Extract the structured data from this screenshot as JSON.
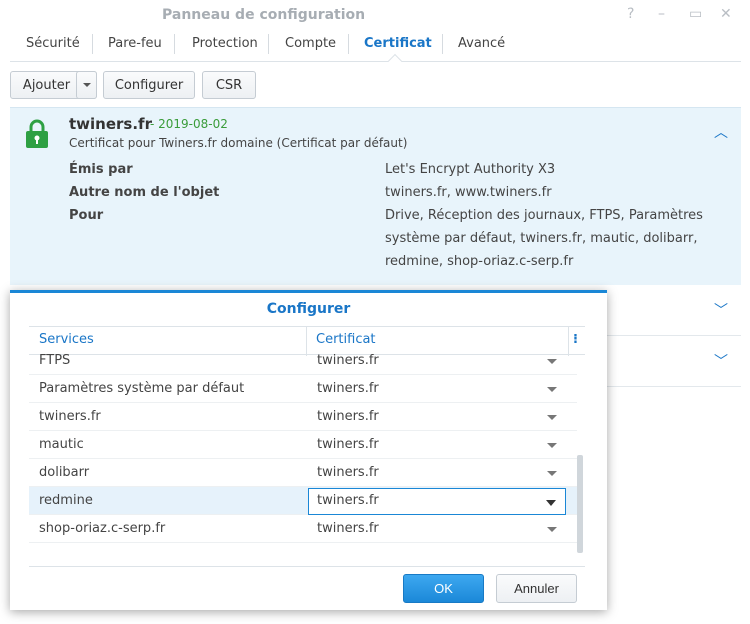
{
  "window": {
    "title": "Panneau de configuration",
    "controls": [
      "help-icon",
      "minimize-icon",
      "maximize-icon",
      "close-icon"
    ]
  },
  "tabs": [
    {
      "label": "Sécurité"
    },
    {
      "label": "Pare-feu"
    },
    {
      "label": "Protection"
    },
    {
      "label": "Compte"
    },
    {
      "label": "Certificat",
      "active": true
    },
    {
      "label": "Avancé"
    }
  ],
  "toolbar": {
    "add_label": "Ajouter",
    "configure_label": "Configurer",
    "csr_label": "CSR"
  },
  "certificate": {
    "name": "twiners.fr",
    "date": "- 2019-08-02",
    "description": "Certificat pour Twiners.fr domaine (Certificat par défaut)",
    "fields": [
      {
        "label": "Émis par",
        "value": "Let's Encrypt Authority X3"
      },
      {
        "label": "Autre nom de l'objet",
        "value": "twiners.fr, www.twiners.fr"
      },
      {
        "label": "Pour",
        "value": "Drive, Réception des journaux, FTPS, Paramètres système par défaut, twiners.fr, mautic, dolibarr, redmine, shop-oriaz.c-serp.fr"
      }
    ]
  },
  "dialog": {
    "title": "Configurer",
    "columns": [
      "Services",
      "Certificat"
    ],
    "rows": [
      {
        "service": "FTPS",
        "certificate": "twiners.fr"
      },
      {
        "service": "Paramètres système par défaut",
        "certificate": "twiners.fr"
      },
      {
        "service": "twiners.fr",
        "certificate": "twiners.fr"
      },
      {
        "service": "mautic",
        "certificate": "twiners.fr"
      },
      {
        "service": "dolibarr",
        "certificate": "twiners.fr"
      },
      {
        "service": "redmine",
        "certificate": "twiners.fr",
        "selected": true
      },
      {
        "service": "shop-oriaz.c-serp.fr",
        "certificate": "twiners.fr"
      }
    ],
    "ok_label": "OK",
    "cancel_label": "Annuler"
  },
  "colors": {
    "accent": "#1a76c7",
    "panel_bg": "#e8f4fb",
    "date_green": "#3a9c3a",
    "lock_green": "#2ea043"
  }
}
